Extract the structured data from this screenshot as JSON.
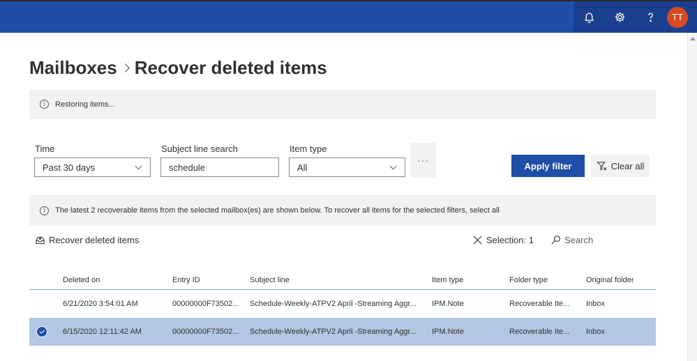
{
  "topbar": {
    "icons": [
      "bell-icon",
      "gear-icon",
      "help-icon"
    ],
    "avatar_initials": "TT",
    "brand_color": "#1f4ea8",
    "avatar_color": "#d94a1e"
  },
  "breadcrumb": {
    "parent": "Mailboxes",
    "current": "Recover deleted items"
  },
  "status_bar": {
    "message": "Restoring items..."
  },
  "filters": {
    "time": {
      "label": "Time",
      "value": "Past 30 days"
    },
    "subject": {
      "label": "Subject line search",
      "value": "schedule"
    },
    "item_type": {
      "label": "Item type",
      "value": "All"
    },
    "more": "···",
    "apply_label": "Apply filter",
    "clear_label": "Clear all"
  },
  "notice": {
    "message": "The latest 2 recoverable items from the selected mailbox(es) are shown below. To recover all items for the selected filters, select all"
  },
  "actions": {
    "recover_label": "Recover deleted items",
    "selection_label": "Selection: 1",
    "search_label": "Search"
  },
  "table": {
    "columns": [
      "Deleted on",
      "Entry ID",
      "Subject line",
      "Item type",
      "Folder type",
      "Original folder"
    ],
    "rows": [
      {
        "selected": false,
        "cells": [
          "6/21/2020 3:54:01 AM",
          "00000000F73502...",
          "Schedule-Weekly-ATPV2 April -Streaming Aggr...",
          "IPM.Note",
          "Recoverable Ite...",
          "Inbox"
        ]
      },
      {
        "selected": true,
        "cells": [
          "6/15/2020 12:11:42 AM",
          "00000000F73502...",
          "Schedule-Weekly-ATPV2 April -Streaming Aggr...",
          "IPM.Note",
          "Recoverable Ite...",
          "Inbox"
        ]
      }
    ]
  }
}
